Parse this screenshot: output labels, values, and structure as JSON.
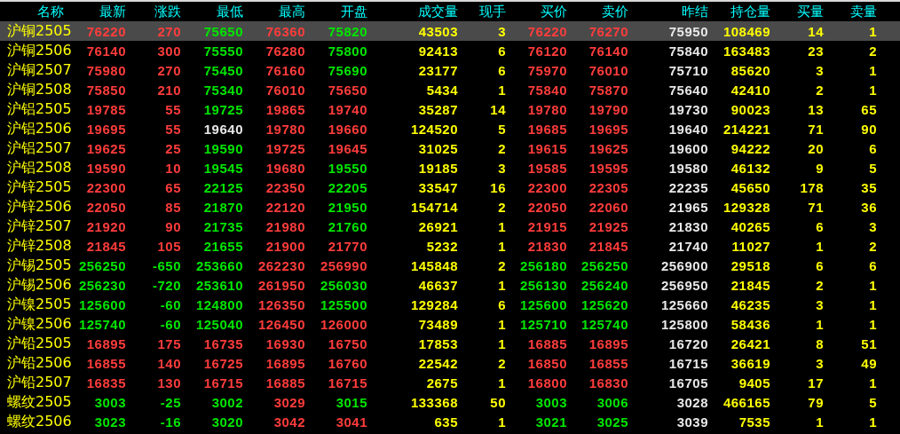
{
  "table": {
    "columns": [
      "名称",
      "最新",
      "涨跌",
      "最低",
      "最高",
      "开盘",
      "成交量",
      "现手",
      "买价",
      "卖价",
      "昨结",
      "持仓量",
      "买量",
      "卖量"
    ],
    "rows": [
      {
        "selected": true,
        "cells": [
          {
            "text": "沪铜2505",
            "color": "#ffff00"
          },
          {
            "text": "76220",
            "color": "#ff3c3c"
          },
          {
            "text": "270",
            "color": "#ff3c3c"
          },
          {
            "text": "75650",
            "color": "#00e600"
          },
          {
            "text": "76360",
            "color": "#ff3c3c"
          },
          {
            "text": "75820",
            "color": "#00e600"
          },
          {
            "text": "43503",
            "color": "#ffff00"
          },
          {
            "text": "3",
            "color": "#ffff00"
          },
          {
            "text": "76220",
            "color": "#ff3c3c"
          },
          {
            "text": "76270",
            "color": "#ff3c3c"
          },
          {
            "text": "75950",
            "color": "#e8e8e8"
          },
          {
            "text": "108469",
            "color": "#ffff00"
          },
          {
            "text": "14",
            "color": "#ffff00"
          },
          {
            "text": "1",
            "color": "#ffff00"
          }
        ]
      },
      {
        "selected": false,
        "cells": [
          {
            "text": "沪铜2506",
            "color": "#ffff00"
          },
          {
            "text": "76140",
            "color": "#ff3c3c"
          },
          {
            "text": "300",
            "color": "#ff3c3c"
          },
          {
            "text": "75550",
            "color": "#00e600"
          },
          {
            "text": "76280",
            "color": "#ff3c3c"
          },
          {
            "text": "75800",
            "color": "#00e600"
          },
          {
            "text": "92413",
            "color": "#ffff00"
          },
          {
            "text": "6",
            "color": "#ffff00"
          },
          {
            "text": "76120",
            "color": "#ff3c3c"
          },
          {
            "text": "76140",
            "color": "#ff3c3c"
          },
          {
            "text": "75840",
            "color": "#e8e8e8"
          },
          {
            "text": "163483",
            "color": "#ffff00"
          },
          {
            "text": "23",
            "color": "#ffff00"
          },
          {
            "text": "2",
            "color": "#ffff00"
          }
        ]
      },
      {
        "selected": false,
        "cells": [
          {
            "text": "沪铜2507",
            "color": "#ffff00"
          },
          {
            "text": "75980",
            "color": "#ff3c3c"
          },
          {
            "text": "270",
            "color": "#ff3c3c"
          },
          {
            "text": "75450",
            "color": "#00e600"
          },
          {
            "text": "76160",
            "color": "#ff3c3c"
          },
          {
            "text": "75690",
            "color": "#00e600"
          },
          {
            "text": "23177",
            "color": "#ffff00"
          },
          {
            "text": "6",
            "color": "#ffff00"
          },
          {
            "text": "75970",
            "color": "#ff3c3c"
          },
          {
            "text": "76010",
            "color": "#ff3c3c"
          },
          {
            "text": "75710",
            "color": "#e8e8e8"
          },
          {
            "text": "85620",
            "color": "#ffff00"
          },
          {
            "text": "3",
            "color": "#ffff00"
          },
          {
            "text": "1",
            "color": "#ffff00"
          }
        ]
      },
      {
        "selected": false,
        "cells": [
          {
            "text": "沪铜2508",
            "color": "#ffff00"
          },
          {
            "text": "75850",
            "color": "#ff3c3c"
          },
          {
            "text": "210",
            "color": "#ff3c3c"
          },
          {
            "text": "75340",
            "color": "#00e600"
          },
          {
            "text": "76010",
            "color": "#ff3c3c"
          },
          {
            "text": "75650",
            "color": "#ff3c3c"
          },
          {
            "text": "5434",
            "color": "#ffff00"
          },
          {
            "text": "1",
            "color": "#ffff00"
          },
          {
            "text": "75840",
            "color": "#ff3c3c"
          },
          {
            "text": "75870",
            "color": "#ff3c3c"
          },
          {
            "text": "75640",
            "color": "#e8e8e8"
          },
          {
            "text": "42410",
            "color": "#ffff00"
          },
          {
            "text": "2",
            "color": "#ffff00"
          },
          {
            "text": "1",
            "color": "#ffff00"
          }
        ]
      },
      {
        "selected": false,
        "cells": [
          {
            "text": "沪铝2505",
            "color": "#ffff00"
          },
          {
            "text": "19785",
            "color": "#ff3c3c"
          },
          {
            "text": "55",
            "color": "#ff3c3c"
          },
          {
            "text": "19725",
            "color": "#00e600"
          },
          {
            "text": "19865",
            "color": "#ff3c3c"
          },
          {
            "text": "19740",
            "color": "#ff3c3c"
          },
          {
            "text": "35287",
            "color": "#ffff00"
          },
          {
            "text": "14",
            "color": "#ffff00"
          },
          {
            "text": "19780",
            "color": "#ff3c3c"
          },
          {
            "text": "19790",
            "color": "#ff3c3c"
          },
          {
            "text": "19730",
            "color": "#e8e8e8"
          },
          {
            "text": "90023",
            "color": "#ffff00"
          },
          {
            "text": "13",
            "color": "#ffff00"
          },
          {
            "text": "65",
            "color": "#ffff00"
          }
        ]
      },
      {
        "selected": false,
        "cells": [
          {
            "text": "沪铝2506",
            "color": "#ffff00"
          },
          {
            "text": "19695",
            "color": "#ff3c3c"
          },
          {
            "text": "55",
            "color": "#ff3c3c"
          },
          {
            "text": "19640",
            "color": "#e8e8e8"
          },
          {
            "text": "19780",
            "color": "#ff3c3c"
          },
          {
            "text": "19660",
            "color": "#ff3c3c"
          },
          {
            "text": "124520",
            "color": "#ffff00"
          },
          {
            "text": "5",
            "color": "#ffff00"
          },
          {
            "text": "19685",
            "color": "#ff3c3c"
          },
          {
            "text": "19695",
            "color": "#ff3c3c"
          },
          {
            "text": "19640",
            "color": "#e8e8e8"
          },
          {
            "text": "214221",
            "color": "#ffff00"
          },
          {
            "text": "71",
            "color": "#ffff00"
          },
          {
            "text": "90",
            "color": "#ffff00"
          }
        ]
      },
      {
        "selected": false,
        "cells": [
          {
            "text": "沪铝2507",
            "color": "#ffff00"
          },
          {
            "text": "19625",
            "color": "#ff3c3c"
          },
          {
            "text": "25",
            "color": "#ff3c3c"
          },
          {
            "text": "19590",
            "color": "#00e600"
          },
          {
            "text": "19725",
            "color": "#ff3c3c"
          },
          {
            "text": "19645",
            "color": "#ff3c3c"
          },
          {
            "text": "31025",
            "color": "#ffff00"
          },
          {
            "text": "2",
            "color": "#ffff00"
          },
          {
            "text": "19615",
            "color": "#ff3c3c"
          },
          {
            "text": "19625",
            "color": "#ff3c3c"
          },
          {
            "text": "19600",
            "color": "#e8e8e8"
          },
          {
            "text": "94222",
            "color": "#ffff00"
          },
          {
            "text": "20",
            "color": "#ffff00"
          },
          {
            "text": "6",
            "color": "#ffff00"
          }
        ]
      },
      {
        "selected": false,
        "cells": [
          {
            "text": "沪铝2508",
            "color": "#ffff00"
          },
          {
            "text": "19590",
            "color": "#ff3c3c"
          },
          {
            "text": "10",
            "color": "#ff3c3c"
          },
          {
            "text": "19545",
            "color": "#00e600"
          },
          {
            "text": "19680",
            "color": "#ff3c3c"
          },
          {
            "text": "19550",
            "color": "#00e600"
          },
          {
            "text": "19185",
            "color": "#ffff00"
          },
          {
            "text": "3",
            "color": "#ffff00"
          },
          {
            "text": "19585",
            "color": "#ff3c3c"
          },
          {
            "text": "19595",
            "color": "#ff3c3c"
          },
          {
            "text": "19580",
            "color": "#e8e8e8"
          },
          {
            "text": "46132",
            "color": "#ffff00"
          },
          {
            "text": "9",
            "color": "#ffff00"
          },
          {
            "text": "5",
            "color": "#ffff00"
          }
        ]
      },
      {
        "selected": false,
        "cells": [
          {
            "text": "沪锌2505",
            "color": "#ffff00"
          },
          {
            "text": "22300",
            "color": "#ff3c3c"
          },
          {
            "text": "65",
            "color": "#ff3c3c"
          },
          {
            "text": "22125",
            "color": "#00e600"
          },
          {
            "text": "22350",
            "color": "#ff3c3c"
          },
          {
            "text": "22205",
            "color": "#00e600"
          },
          {
            "text": "33547",
            "color": "#ffff00"
          },
          {
            "text": "16",
            "color": "#ffff00"
          },
          {
            "text": "22300",
            "color": "#ff3c3c"
          },
          {
            "text": "22305",
            "color": "#ff3c3c"
          },
          {
            "text": "22235",
            "color": "#e8e8e8"
          },
          {
            "text": "45650",
            "color": "#ffff00"
          },
          {
            "text": "178",
            "color": "#ffff00"
          },
          {
            "text": "35",
            "color": "#ffff00"
          }
        ]
      },
      {
        "selected": false,
        "cells": [
          {
            "text": "沪锌2506",
            "color": "#ffff00"
          },
          {
            "text": "22050",
            "color": "#ff3c3c"
          },
          {
            "text": "85",
            "color": "#ff3c3c"
          },
          {
            "text": "21870",
            "color": "#00e600"
          },
          {
            "text": "22120",
            "color": "#ff3c3c"
          },
          {
            "text": "21950",
            "color": "#00e600"
          },
          {
            "text": "154714",
            "color": "#ffff00"
          },
          {
            "text": "2",
            "color": "#ffff00"
          },
          {
            "text": "22050",
            "color": "#ff3c3c"
          },
          {
            "text": "22060",
            "color": "#ff3c3c"
          },
          {
            "text": "21965",
            "color": "#e8e8e8"
          },
          {
            "text": "129328",
            "color": "#ffff00"
          },
          {
            "text": "71",
            "color": "#ffff00"
          },
          {
            "text": "36",
            "color": "#ffff00"
          }
        ]
      },
      {
        "selected": false,
        "cells": [
          {
            "text": "沪锌2507",
            "color": "#ffff00"
          },
          {
            "text": "21920",
            "color": "#ff3c3c"
          },
          {
            "text": "90",
            "color": "#ff3c3c"
          },
          {
            "text": "21735",
            "color": "#00e600"
          },
          {
            "text": "21980",
            "color": "#ff3c3c"
          },
          {
            "text": "21760",
            "color": "#00e600"
          },
          {
            "text": "26921",
            "color": "#ffff00"
          },
          {
            "text": "1",
            "color": "#ffff00"
          },
          {
            "text": "21915",
            "color": "#ff3c3c"
          },
          {
            "text": "21925",
            "color": "#ff3c3c"
          },
          {
            "text": "21830",
            "color": "#e8e8e8"
          },
          {
            "text": "40265",
            "color": "#ffff00"
          },
          {
            "text": "6",
            "color": "#ffff00"
          },
          {
            "text": "3",
            "color": "#ffff00"
          }
        ]
      },
      {
        "selected": false,
        "cells": [
          {
            "text": "沪锌2508",
            "color": "#ffff00"
          },
          {
            "text": "21845",
            "color": "#ff3c3c"
          },
          {
            "text": "105",
            "color": "#ff3c3c"
          },
          {
            "text": "21655",
            "color": "#00e600"
          },
          {
            "text": "21900",
            "color": "#ff3c3c"
          },
          {
            "text": "21770",
            "color": "#ff3c3c"
          },
          {
            "text": "5232",
            "color": "#ffff00"
          },
          {
            "text": "1",
            "color": "#ffff00"
          },
          {
            "text": "21830",
            "color": "#ff3c3c"
          },
          {
            "text": "21845",
            "color": "#ff3c3c"
          },
          {
            "text": "21740",
            "color": "#e8e8e8"
          },
          {
            "text": "11027",
            "color": "#ffff00"
          },
          {
            "text": "1",
            "color": "#ffff00"
          },
          {
            "text": "2",
            "color": "#ffff00"
          }
        ]
      },
      {
        "selected": false,
        "cells": [
          {
            "text": "沪锡2505",
            "color": "#ffff00"
          },
          {
            "text": "256250",
            "color": "#00e600"
          },
          {
            "text": "-650",
            "color": "#00e600"
          },
          {
            "text": "253660",
            "color": "#00e600"
          },
          {
            "text": "262230",
            "color": "#ff3c3c"
          },
          {
            "text": "256990",
            "color": "#ff3c3c"
          },
          {
            "text": "145848",
            "color": "#ffff00"
          },
          {
            "text": "2",
            "color": "#ffff00"
          },
          {
            "text": "256180",
            "color": "#00e600"
          },
          {
            "text": "256250",
            "color": "#00e600"
          },
          {
            "text": "256900",
            "color": "#e8e8e8"
          },
          {
            "text": "29518",
            "color": "#ffff00"
          },
          {
            "text": "6",
            "color": "#ffff00"
          },
          {
            "text": "6",
            "color": "#ffff00"
          }
        ]
      },
      {
        "selected": false,
        "cells": [
          {
            "text": "沪锡2506",
            "color": "#ffff00"
          },
          {
            "text": "256230",
            "color": "#00e600"
          },
          {
            "text": "-720",
            "color": "#00e600"
          },
          {
            "text": "253610",
            "color": "#00e600"
          },
          {
            "text": "261950",
            "color": "#ff3c3c"
          },
          {
            "text": "256030",
            "color": "#00e600"
          },
          {
            "text": "46637",
            "color": "#ffff00"
          },
          {
            "text": "1",
            "color": "#ffff00"
          },
          {
            "text": "256130",
            "color": "#00e600"
          },
          {
            "text": "256240",
            "color": "#00e600"
          },
          {
            "text": "256950",
            "color": "#e8e8e8"
          },
          {
            "text": "21845",
            "color": "#ffff00"
          },
          {
            "text": "2",
            "color": "#ffff00"
          },
          {
            "text": "1",
            "color": "#ffff00"
          }
        ]
      },
      {
        "selected": false,
        "cells": [
          {
            "text": "沪镍2505",
            "color": "#ffff00"
          },
          {
            "text": "125600",
            "color": "#00e600"
          },
          {
            "text": "-60",
            "color": "#00e600"
          },
          {
            "text": "124800",
            "color": "#00e600"
          },
          {
            "text": "126350",
            "color": "#ff3c3c"
          },
          {
            "text": "125500",
            "color": "#00e600"
          },
          {
            "text": "129284",
            "color": "#ffff00"
          },
          {
            "text": "6",
            "color": "#ffff00"
          },
          {
            "text": "125600",
            "color": "#00e600"
          },
          {
            "text": "125620",
            "color": "#00e600"
          },
          {
            "text": "125660",
            "color": "#e8e8e8"
          },
          {
            "text": "46235",
            "color": "#ffff00"
          },
          {
            "text": "3",
            "color": "#ffff00"
          },
          {
            "text": "1",
            "color": "#ffff00"
          }
        ]
      },
      {
        "selected": false,
        "cells": [
          {
            "text": "沪镍2506",
            "color": "#ffff00"
          },
          {
            "text": "125740",
            "color": "#00e600"
          },
          {
            "text": "-60",
            "color": "#00e600"
          },
          {
            "text": "125040",
            "color": "#00e600"
          },
          {
            "text": "126450",
            "color": "#ff3c3c"
          },
          {
            "text": "126000",
            "color": "#ff3c3c"
          },
          {
            "text": "73489",
            "color": "#ffff00"
          },
          {
            "text": "1",
            "color": "#ffff00"
          },
          {
            "text": "125710",
            "color": "#00e600"
          },
          {
            "text": "125740",
            "color": "#00e600"
          },
          {
            "text": "125800",
            "color": "#e8e8e8"
          },
          {
            "text": "58436",
            "color": "#ffff00"
          },
          {
            "text": "1",
            "color": "#ffff00"
          },
          {
            "text": "1",
            "color": "#ffff00"
          }
        ]
      },
      {
        "selected": false,
        "cells": [
          {
            "text": "沪铅2505",
            "color": "#ffff00"
          },
          {
            "text": "16895",
            "color": "#ff3c3c"
          },
          {
            "text": "175",
            "color": "#ff3c3c"
          },
          {
            "text": "16735",
            "color": "#ff3c3c"
          },
          {
            "text": "16930",
            "color": "#ff3c3c"
          },
          {
            "text": "16750",
            "color": "#ff3c3c"
          },
          {
            "text": "17853",
            "color": "#ffff00"
          },
          {
            "text": "1",
            "color": "#ffff00"
          },
          {
            "text": "16885",
            "color": "#ff3c3c"
          },
          {
            "text": "16895",
            "color": "#ff3c3c"
          },
          {
            "text": "16720",
            "color": "#e8e8e8"
          },
          {
            "text": "26421",
            "color": "#ffff00"
          },
          {
            "text": "8",
            "color": "#ffff00"
          },
          {
            "text": "51",
            "color": "#ffff00"
          }
        ]
      },
      {
        "selected": false,
        "cells": [
          {
            "text": "沪铅2506",
            "color": "#ffff00"
          },
          {
            "text": "16855",
            "color": "#ff3c3c"
          },
          {
            "text": "140",
            "color": "#ff3c3c"
          },
          {
            "text": "16725",
            "color": "#ff3c3c"
          },
          {
            "text": "16895",
            "color": "#ff3c3c"
          },
          {
            "text": "16760",
            "color": "#ff3c3c"
          },
          {
            "text": "22542",
            "color": "#ffff00"
          },
          {
            "text": "2",
            "color": "#ffff00"
          },
          {
            "text": "16850",
            "color": "#ff3c3c"
          },
          {
            "text": "16855",
            "color": "#ff3c3c"
          },
          {
            "text": "16715",
            "color": "#e8e8e8"
          },
          {
            "text": "36619",
            "color": "#ffff00"
          },
          {
            "text": "3",
            "color": "#ffff00"
          },
          {
            "text": "49",
            "color": "#ffff00"
          }
        ]
      },
      {
        "selected": false,
        "cells": [
          {
            "text": "沪铅2507",
            "color": "#ffff00"
          },
          {
            "text": "16835",
            "color": "#ff3c3c"
          },
          {
            "text": "130",
            "color": "#ff3c3c"
          },
          {
            "text": "16715",
            "color": "#ff3c3c"
          },
          {
            "text": "16885",
            "color": "#ff3c3c"
          },
          {
            "text": "16715",
            "color": "#ff3c3c"
          },
          {
            "text": "2675",
            "color": "#ffff00"
          },
          {
            "text": "1",
            "color": "#ffff00"
          },
          {
            "text": "16800",
            "color": "#ff3c3c"
          },
          {
            "text": "16830",
            "color": "#ff3c3c"
          },
          {
            "text": "16705",
            "color": "#e8e8e8"
          },
          {
            "text": "9405",
            "color": "#ffff00"
          },
          {
            "text": "17",
            "color": "#ffff00"
          },
          {
            "text": "1",
            "color": "#ffff00"
          }
        ]
      },
      {
        "selected": false,
        "cells": [
          {
            "text": "螺纹2505",
            "color": "#ffff00"
          },
          {
            "text": "3003",
            "color": "#00e600"
          },
          {
            "text": "-25",
            "color": "#00e600"
          },
          {
            "text": "3002",
            "color": "#00e600"
          },
          {
            "text": "3029",
            "color": "#ff3c3c"
          },
          {
            "text": "3015",
            "color": "#00e600"
          },
          {
            "text": "133368",
            "color": "#ffff00"
          },
          {
            "text": "50",
            "color": "#ffff00"
          },
          {
            "text": "3003",
            "color": "#00e600"
          },
          {
            "text": "3006",
            "color": "#00e600"
          },
          {
            "text": "3028",
            "color": "#e8e8e8"
          },
          {
            "text": "466165",
            "color": "#ffff00"
          },
          {
            "text": "79",
            "color": "#ffff00"
          },
          {
            "text": "5",
            "color": "#ffff00"
          }
        ]
      },
      {
        "selected": false,
        "cells": [
          {
            "text": "螺纹2506",
            "color": "#ffff00"
          },
          {
            "text": "3023",
            "color": "#00e600"
          },
          {
            "text": "-16",
            "color": "#00e600"
          },
          {
            "text": "3020",
            "color": "#00e600"
          },
          {
            "text": "3042",
            "color": "#ff3c3c"
          },
          {
            "text": "3041",
            "color": "#ff3c3c"
          },
          {
            "text": "635",
            "color": "#ffff00"
          },
          {
            "text": "1",
            "color": "#ffff00"
          },
          {
            "text": "3021",
            "color": "#00e600"
          },
          {
            "text": "3025",
            "color": "#00e600"
          },
          {
            "text": "3039",
            "color": "#e8e8e8"
          },
          {
            "text": "7535",
            "color": "#ffff00"
          },
          {
            "text": "1",
            "color": "#ffff00"
          },
          {
            "text": "1",
            "color": "#ffff00"
          }
        ]
      }
    ]
  }
}
